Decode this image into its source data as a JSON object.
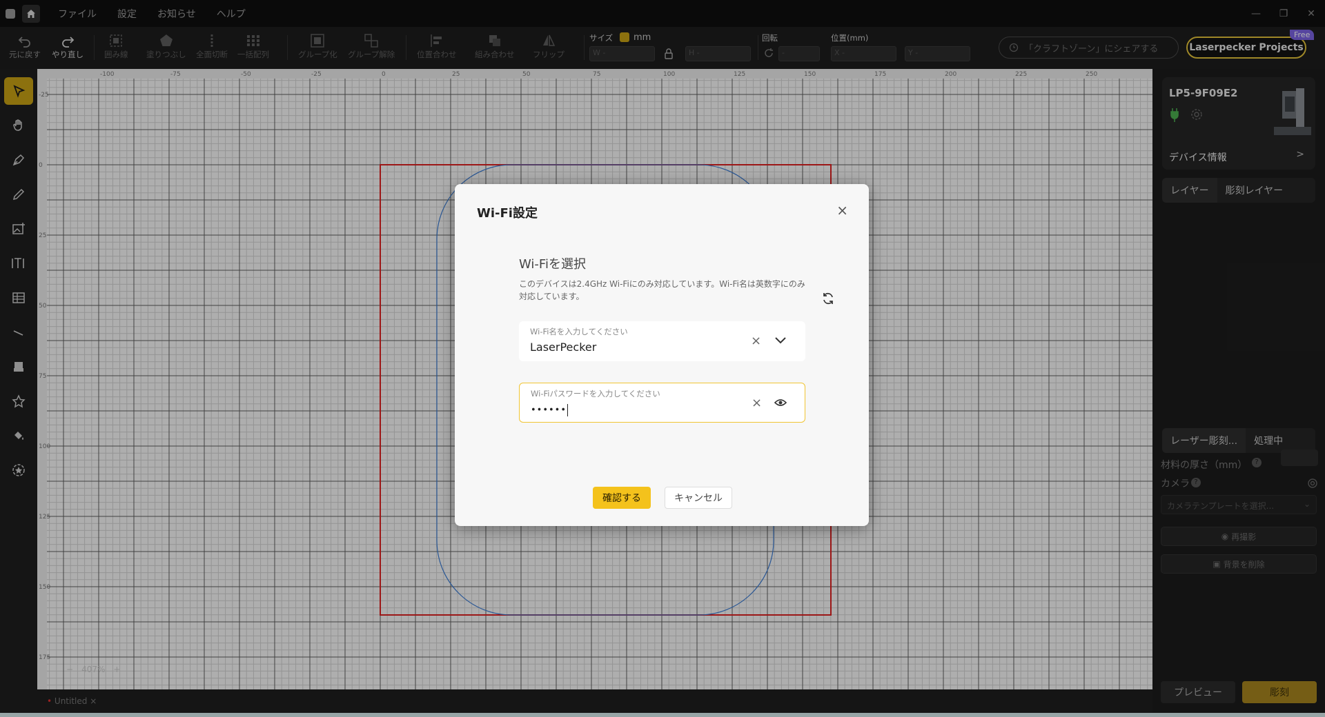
{
  "menu": {
    "file": "ファイル",
    "settings": "設定",
    "news": "お知らせ",
    "help": "ヘルプ"
  },
  "toolbar": {
    "undo": "元に戻す",
    "redo": "やり直し",
    "outline": "囲み線",
    "fill": "塗りつぶし",
    "cut": "全面切断",
    "array": "一括配列",
    "group": "グループ化",
    "ungroup": "グループ解除",
    "align": "位置合わせ",
    "combine": "組み合わせ",
    "flip": "フリップ",
    "size_label": "サイズ",
    "unit": "mm",
    "width_placeholder": "W -",
    "height_placeholder": "H -",
    "rotate_label": "回転",
    "rotate_placeholder": "-",
    "position_label": "位置(mm)",
    "x_placeholder": "X -",
    "y_placeholder": "Y -",
    "share": "「クラフトゾーン」にシェアする",
    "projects": "Laserpecker Projects",
    "free_badge": "Free"
  },
  "ruler": {
    "top": [
      "-100",
      "-75",
      "-50",
      "-25",
      "0",
      "25",
      "50",
      "75",
      "100",
      "125",
      "150",
      "175",
      "200",
      "225",
      "250"
    ],
    "left": [
      "-25",
      "0",
      "25",
      "50",
      "75",
      "100",
      "125",
      "150",
      "175"
    ]
  },
  "zoom": {
    "level": "407%",
    "minus": "−",
    "plus": "+"
  },
  "document": {
    "tab": "Untitled",
    "close": "×"
  },
  "device": {
    "name": "LP5-9F09E2",
    "info": "デバイス情報",
    "chevron": ">"
  },
  "layers": {
    "tab1": "レイヤー",
    "tab2": "彫刻レイヤー"
  },
  "engrave_tabs": {
    "tab1": "レーザー彫刻...",
    "tab2": "処理中"
  },
  "panel": {
    "thickness": "材料の厚さ（mm）",
    "camera": "カメラ",
    "camera_template": "カメラテンプレートを選択...",
    "reshoot": "再撮影",
    "remove_bg": "背景を削除",
    "preview": "プレビュー",
    "engrave": "彫刻"
  },
  "dialog": {
    "title": "Wi-Fi設定",
    "close": "×",
    "section_title": "Wi-Fiを選択",
    "description": "このデバイスは2.4GHz Wi-Fiにのみ対応しています。Wi-Fi名は英数字にのみ対応しています。",
    "ssid_label": "Wi-Fi名を入力してください",
    "ssid_value": "LaserPecker",
    "password_label": "Wi-Fiパスワードを入力してください",
    "password_value": "••••••",
    "clear": "×",
    "confirm": "確認する",
    "cancel": "キャンセル"
  },
  "colors": {
    "accent": "#f4c21c",
    "frame": "#e02020",
    "shape": "#3a7bd5"
  }
}
